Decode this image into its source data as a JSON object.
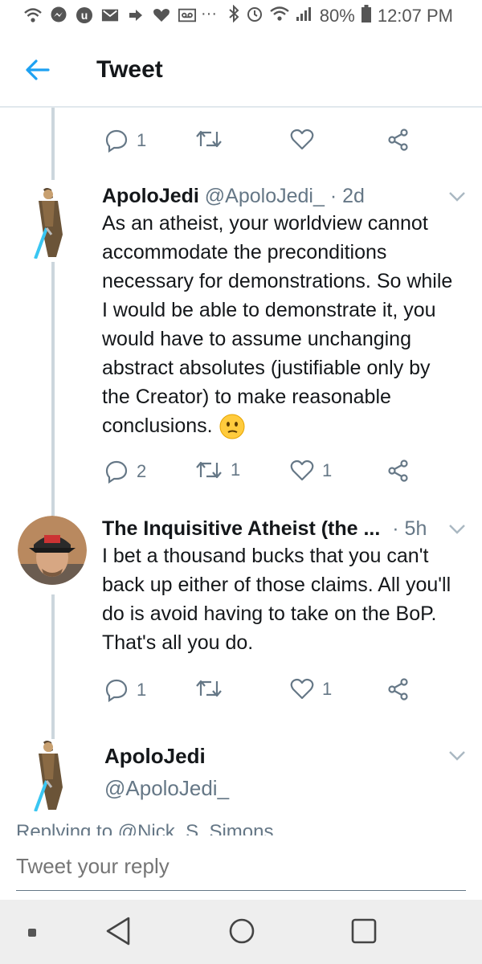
{
  "status_bar": {
    "battery": "80%",
    "time": "12:07 PM",
    "overflow": "···",
    "icons": [
      "wifi-icon",
      "messenger-icon",
      "app-icon",
      "gmail-icon",
      "bolt-icon",
      "heart-icon",
      "voicemail-icon",
      "bluetooth-icon",
      "alarm-icon",
      "wifi-icon",
      "signal-icon",
      "battery-icon"
    ]
  },
  "header": {
    "title": "Tweet",
    "back_icon": "arrow-left-icon"
  },
  "colors": {
    "accent": "#1da1f2",
    "text": "#14171a",
    "muted": "#657786",
    "divider": "#e1e8ed"
  },
  "top_actions": {
    "reply_count": "1",
    "retweet_count": "",
    "like_count": ""
  },
  "tweets": [
    {
      "name": "ApoloJedi",
      "handle": "@ApoloJedi_",
      "time": "· 2d",
      "body": "As an atheist, your worldview cannot accommodate the preconditions necessary for demonstrations. So while I would be able to demonstrate it, you would have to assume unchanging abstract absolutes (justifiable only by the Creator) to make reasonable conclusions.",
      "emoji": "confused-face-emoji",
      "reply_count": "2",
      "retweet_count": "1",
      "like_count": "1"
    },
    {
      "name": "The Inquisitive Atheist (the ...",
      "handle": "",
      "time": "· 5h",
      "body": "I bet a thousand bucks that you can't back up either of those claims. All you'll do is avoid having to take on the BoP. That's all you do.",
      "reply_count": "1",
      "retweet_count": "",
      "like_count": "1"
    },
    {
      "name": "ApoloJedi",
      "handle": "@ApoloJedi_"
    }
  ],
  "reply": {
    "replying_to": "Replying to @Nick_S_Simons",
    "placeholder": "Tweet your reply"
  },
  "nav": [
    "recents-button",
    "back-button",
    "home-button",
    "overview-button"
  ]
}
